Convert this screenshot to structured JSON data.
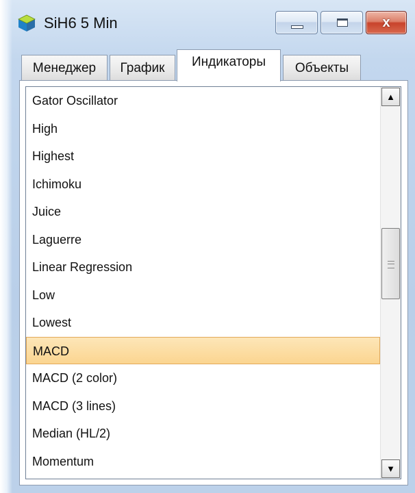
{
  "window": {
    "title": "SiH6 5 Min",
    "close_glyph": "x"
  },
  "tabs": [
    {
      "label": "Менеджер"
    },
    {
      "label": "График"
    },
    {
      "label": "Индикаторы"
    },
    {
      "label": "Объекты"
    }
  ],
  "active_tab": "Индикаторы",
  "list": {
    "items": [
      {
        "label": "Gator Oscillator"
      },
      {
        "label": "High"
      },
      {
        "label": "Highest"
      },
      {
        "label": "Ichimoku"
      },
      {
        "label": "Juice"
      },
      {
        "label": "Laguerre"
      },
      {
        "label": "Linear Regression"
      },
      {
        "label": "Low"
      },
      {
        "label": "Lowest"
      },
      {
        "label": "MACD"
      },
      {
        "label": "MACD (2 color)"
      },
      {
        "label": "MACD (3 lines)"
      },
      {
        "label": "Median (HL/2)"
      },
      {
        "label": "Momentum"
      }
    ],
    "selected": "MACD"
  },
  "scrollbar": {
    "up_glyph": "▲",
    "down_glyph": "▼"
  },
  "colors": {
    "selection_bg": "#fbd590",
    "selection_border": "#e2a95a",
    "close_button": "#c8432c",
    "frame": "#c3d7ee"
  },
  "icons": {
    "app": "cube-icon",
    "minimize": "minimize-icon",
    "maximize": "maximize-icon",
    "close": "close-icon",
    "scroll_up": "arrow-up-icon",
    "scroll_down": "arrow-down-icon",
    "thumb_grip": "grip-icon"
  }
}
